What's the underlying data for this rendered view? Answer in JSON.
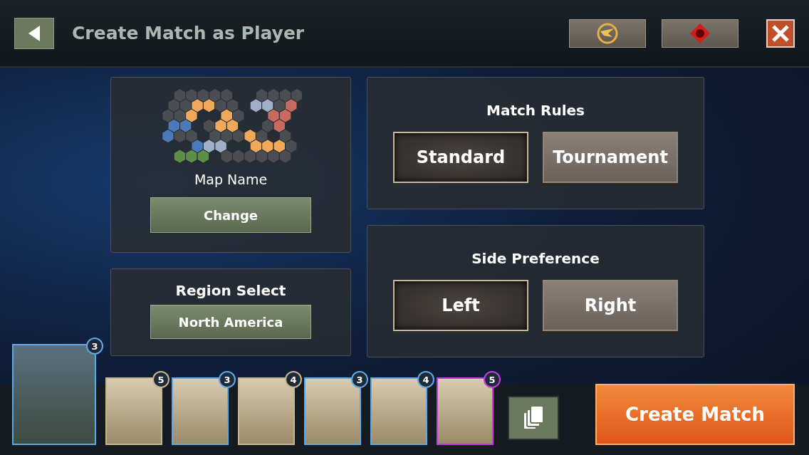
{
  "header": {
    "title": "Create Match as Player"
  },
  "map": {
    "name": "Map Name",
    "button": "Change"
  },
  "region": {
    "title": "Region Select",
    "button": "North America"
  },
  "match_rules": {
    "title": "Match Rules",
    "options": [
      {
        "label": "Standard",
        "selected": true
      },
      {
        "label": "Tournament",
        "selected": false
      }
    ]
  },
  "side_preference": {
    "title": "Side Preference",
    "options": [
      {
        "label": "Left",
        "selected": true
      },
      {
        "label": "Right",
        "selected": false
      }
    ]
  },
  "commander": {
    "level": "3",
    "color": "#5ea8e8"
  },
  "deck": [
    {
      "level": "5",
      "color": "#c9b48c"
    },
    {
      "level": "3",
      "color": "#5ea8e8"
    },
    {
      "level": "4",
      "color": "#c9b48c"
    },
    {
      "level": "3",
      "color": "#5ea8e8"
    },
    {
      "level": "4",
      "color": "#5ea8e8"
    },
    {
      "level": "5",
      "color": "#c13ee0"
    }
  ],
  "create_button": "Create Match"
}
